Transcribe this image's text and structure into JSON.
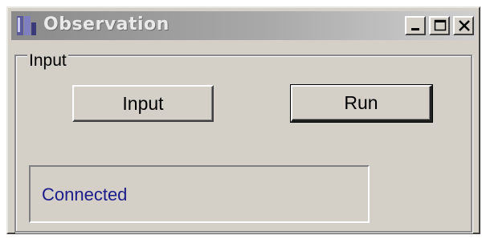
{
  "window": {
    "title": "Observation",
    "controls": {
      "minimize_icon": "minimize-icon",
      "maximize_icon": "maximize-icon",
      "close_icon": "close-icon"
    }
  },
  "group": {
    "label": "Input"
  },
  "buttons": {
    "input_label": "Input",
    "run_label": "Run"
  },
  "status": {
    "text": "Connected",
    "color": "#1b1b8a"
  },
  "colors": {
    "face": "#d4d0c8",
    "titlebar_start": "#8a8a8a",
    "titlebar_end": "#cfcfcf"
  }
}
